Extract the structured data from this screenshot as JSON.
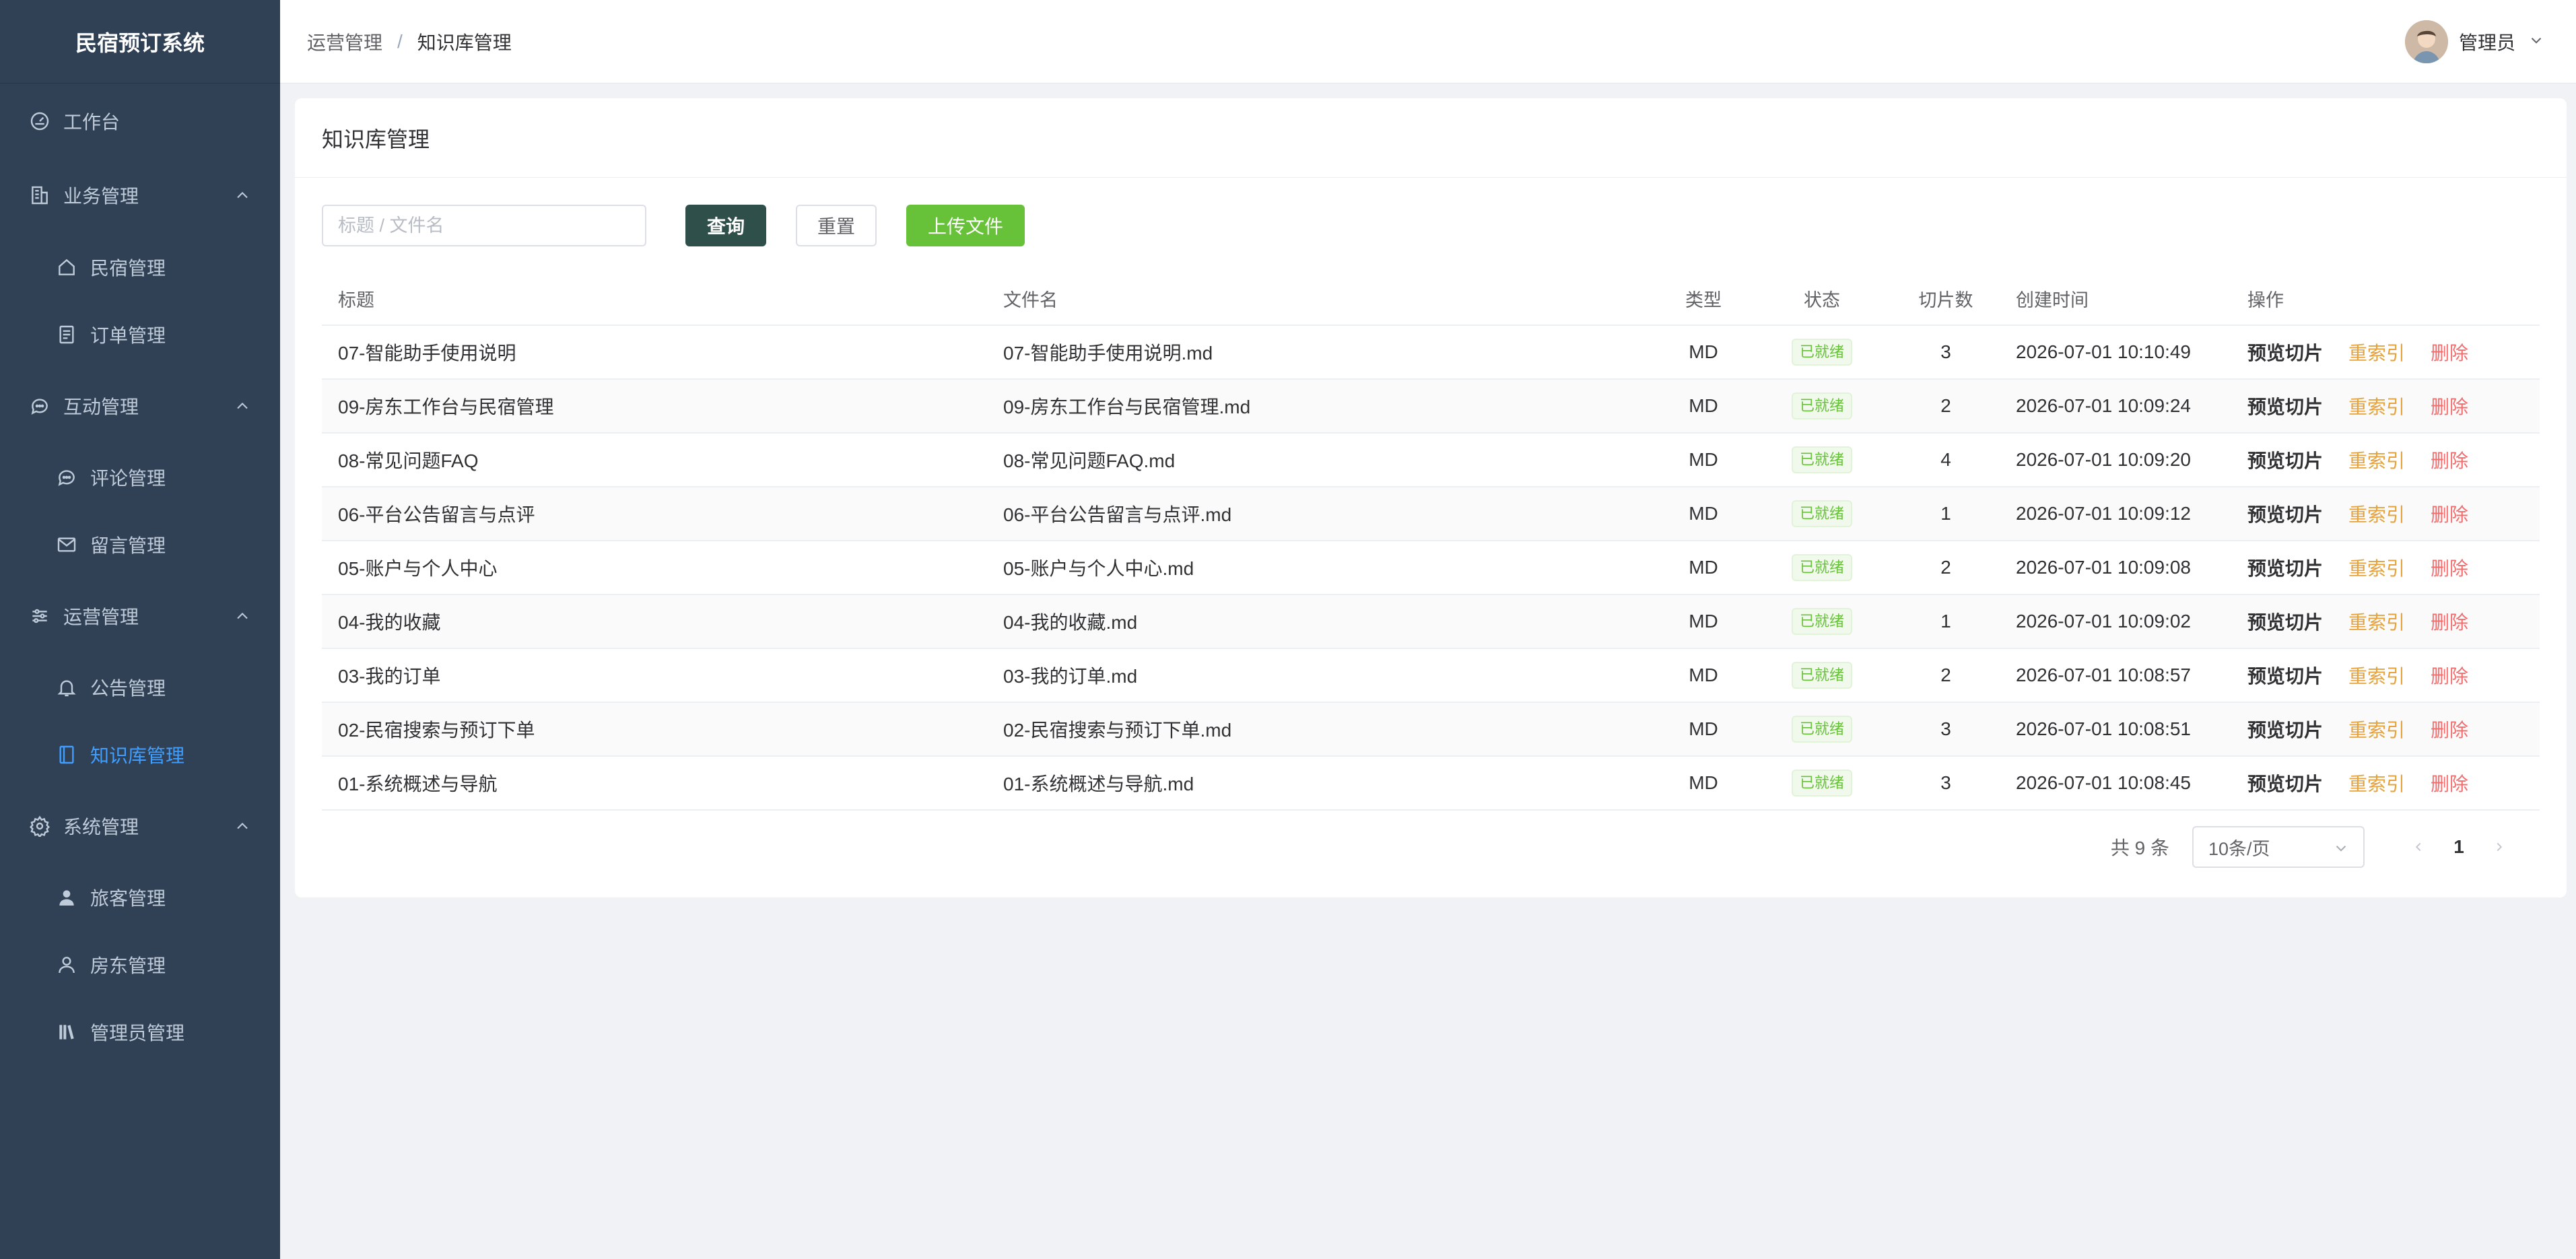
{
  "app": {
    "brand": "民宿预订系统"
  },
  "sidebar": {
    "items": [
      {
        "label": "工作台",
        "icon": "dashboard-icon"
      },
      {
        "label": "业务管理",
        "icon": "building-icon"
      },
      {
        "label": "民宿管理",
        "icon": "home-icon"
      },
      {
        "label": "订单管理",
        "icon": "document-icon"
      },
      {
        "label": "互动管理",
        "icon": "chat-icon"
      },
      {
        "label": "评论管理",
        "icon": "chat-icon"
      },
      {
        "label": "留言管理",
        "icon": "mail-icon"
      },
      {
        "label": "运营管理",
        "icon": "sliders-icon"
      },
      {
        "label": "公告管理",
        "icon": "bell-icon"
      },
      {
        "label": "知识库管理",
        "icon": "notebook-icon"
      },
      {
        "label": "系统管理",
        "icon": "gear-icon"
      },
      {
        "label": "旅客管理",
        "icon": "user-solid-icon"
      },
      {
        "label": "房东管理",
        "icon": "user-icon"
      },
      {
        "label": "管理员管理",
        "icon": "books-icon"
      }
    ],
    "active_color": "#409eff",
    "bg_color": "#304156"
  },
  "header": {
    "breadcrumb": [
      "运营管理",
      "知识库管理"
    ],
    "separator": "/",
    "user_name": "管理员"
  },
  "card": {
    "title": "知识库管理",
    "search_placeholder": "标题 / 文件名",
    "search_value": "",
    "query_label": "查询",
    "reset_label": "重置",
    "upload_label": "上传文件"
  },
  "table": {
    "columns": [
      "标题",
      "文件名",
      "类型",
      "状态",
      "切片数",
      "创建时间",
      "操作"
    ],
    "ops": {
      "preview": "预览切片",
      "reindex": "重索引",
      "delete": "删除"
    },
    "rows": [
      {
        "title": "07-智能助手使用说明",
        "file": "07-智能助手使用说明.md",
        "type": "MD",
        "status": "已就绪",
        "count": "3",
        "time": "2026-07-01 10:10:49"
      },
      {
        "title": "09-房东工作台与民宿管理",
        "file": "09-房东工作台与民宿管理.md",
        "type": "MD",
        "status": "已就绪",
        "count": "2",
        "time": "2026-07-01 10:09:24"
      },
      {
        "title": "08-常见问题FAQ",
        "file": "08-常见问题FAQ.md",
        "type": "MD",
        "status": "已就绪",
        "count": "4",
        "time": "2026-07-01 10:09:20"
      },
      {
        "title": "06-平台公告留言与点评",
        "file": "06-平台公告留言与点评.md",
        "type": "MD",
        "status": "已就绪",
        "count": "1",
        "time": "2026-07-01 10:09:12"
      },
      {
        "title": "05-账户与个人中心",
        "file": "05-账户与个人中心.md",
        "type": "MD",
        "status": "已就绪",
        "count": "2",
        "time": "2026-07-01 10:09:08"
      },
      {
        "title": "04-我的收藏",
        "file": "04-我的收藏.md",
        "type": "MD",
        "status": "已就绪",
        "count": "1",
        "time": "2026-07-01 10:09:02"
      },
      {
        "title": "03-我的订单",
        "file": "03-我的订单.md",
        "type": "MD",
        "status": "已就绪",
        "count": "2",
        "time": "2026-07-01 10:08:57"
      },
      {
        "title": "02-民宿搜索与预订下单",
        "file": "02-民宿搜索与预订下单.md",
        "type": "MD",
        "status": "已就绪",
        "count": "3",
        "time": "2026-07-01 10:08:51"
      },
      {
        "title": "01-系统概述与导航",
        "file": "01-系统概述与导航.md",
        "type": "MD",
        "status": "已就绪",
        "count": "3",
        "time": "2026-07-01 10:08:45"
      }
    ]
  },
  "pagination": {
    "total_text": "共 9 条",
    "page_size": "10条/页",
    "current_page": "1"
  },
  "colors": {
    "query_button": "#2f4f4a",
    "upload_button": "#67c23a",
    "reindex": "#e6a23c",
    "delete": "#f56c6c",
    "status_tag": "#67c23a"
  }
}
